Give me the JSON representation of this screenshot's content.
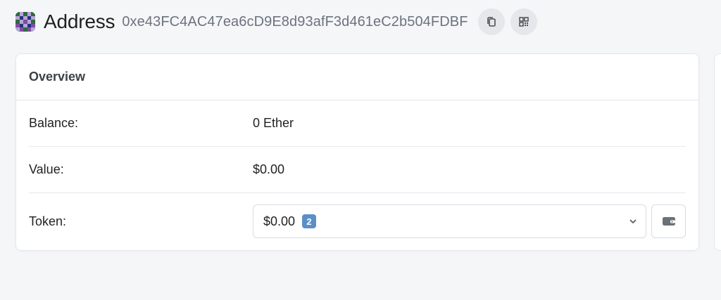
{
  "header": {
    "title": "Address",
    "address": "0xe43FC4AC47ea6cD9E8d93afF3d461eC2b504FDBF",
    "icons": {
      "avatar": "identicon",
      "copy": "copy-icon",
      "qr": "qr-code-icon"
    }
  },
  "overview": {
    "title": "Overview",
    "rows": [
      {
        "label": "Balance:",
        "value": "0 Ether"
      },
      {
        "label": "Value:",
        "value": "$0.00"
      },
      {
        "label": "Token:",
        "value": "$0.00",
        "badge": "2"
      }
    ]
  },
  "colors": {
    "background": "#f5f6f8",
    "badge": "#5b8fc8",
    "muted_text": "#6b7280"
  }
}
